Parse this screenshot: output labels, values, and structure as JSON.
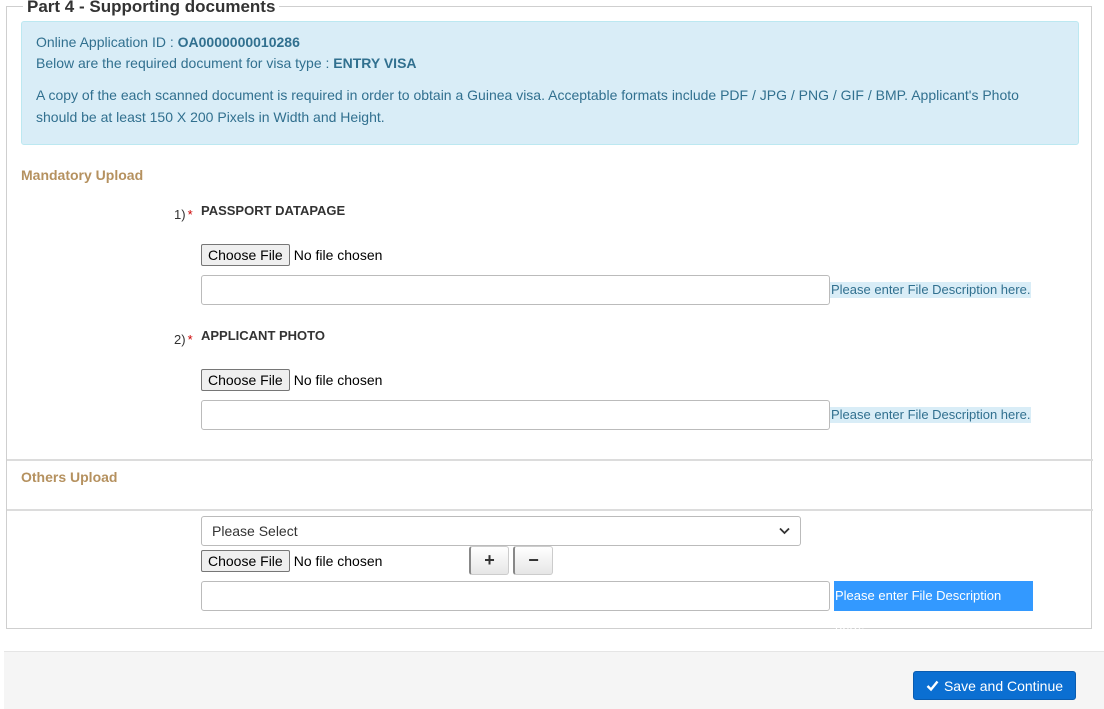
{
  "legend": "Part 4 - Supporting documents",
  "info": {
    "app_id_label": "Online Application ID : ",
    "app_id": "OA0000000010286",
    "visa_type_label": "Below are the required document for visa type : ",
    "visa_type": "ENTRY VISA",
    "description": "A copy of the each scanned document is required in order to obtain a Guinea visa. Acceptable formats include PDF / JPG / PNG / GIF / BMP. Applicant's Photo should be at least 150 X 200 Pixels in Width and Height."
  },
  "mandatory": {
    "title": "Mandatory Upload",
    "docs": [
      {
        "num": "1)",
        "req": "*",
        "label": "PASSPORT DATAPAGE",
        "choose": "Choose File",
        "status": "No file chosen",
        "hint": "Please enter File Description here."
      },
      {
        "num": "2)",
        "req": "*",
        "label": "APPLICANT PHOTO",
        "choose": "Choose File",
        "status": "No file chosen",
        "hint": "Please enter File Description here."
      }
    ]
  },
  "others": {
    "title": "Others Upload",
    "select_value": "Please Select",
    "choose": "Choose File",
    "status": "No file chosen",
    "add": "+",
    "remove": "−",
    "hint": "Please enter File Description here."
  },
  "footer": {
    "save_label": "Save and Continue"
  }
}
